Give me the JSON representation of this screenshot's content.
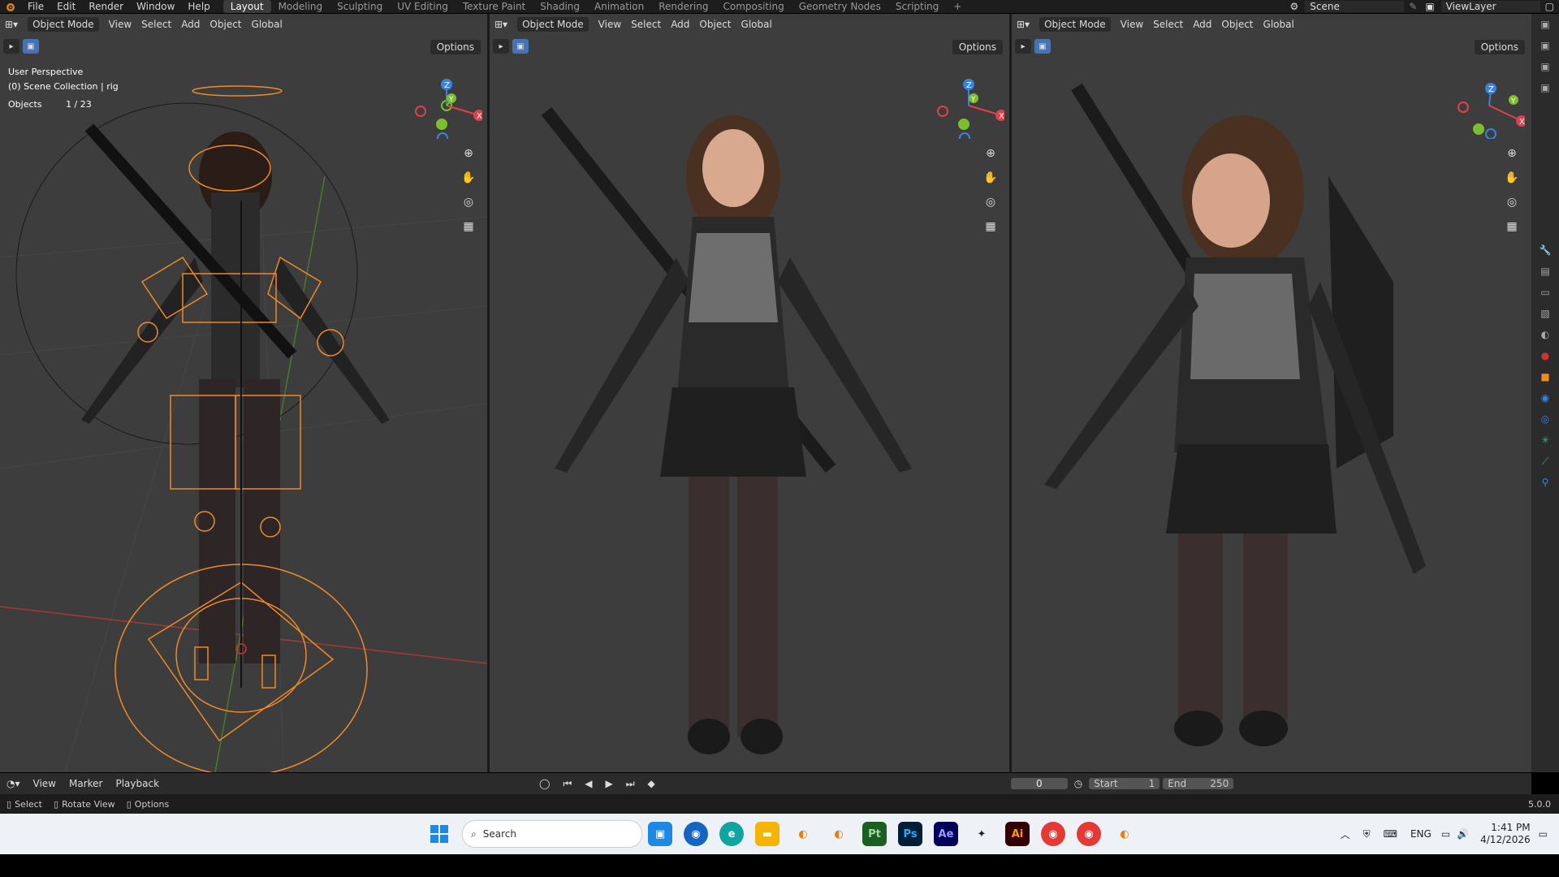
{
  "topbar": {
    "menus": [
      "File",
      "Edit",
      "Render",
      "Window",
      "Help"
    ],
    "workspaces": [
      "Layout",
      "Modeling",
      "Sculpting",
      "UV Editing",
      "Texture Paint",
      "Shading",
      "Animation",
      "Rendering",
      "Compositing",
      "Geometry Nodes",
      "Scripting",
      "+"
    ],
    "active_workspace": "Layout",
    "scene_field": "Scene",
    "viewlayer_field": "ViewLayer"
  },
  "viewport": {
    "mode": "Object Mode",
    "menus": [
      "View",
      "Select",
      "Add",
      "Object"
    ],
    "transform": "Global",
    "options": "Options"
  },
  "left_info": {
    "perspective": "User Perspective",
    "collection": "(0) Scene Collection | rig",
    "objects_label": "Objects",
    "objects_value": "1 / 23"
  },
  "gizmo_axes": {
    "x": "X",
    "y": "Y",
    "z": "Z"
  },
  "timeline": {
    "menus": [
      "View",
      "Marker",
      "Playback"
    ],
    "current_frame": "0",
    "start_label": "Start",
    "start_value": "1",
    "end_label": "End",
    "end_value": "250"
  },
  "statusbar": {
    "select": "Select",
    "rotate": "Rotate View",
    "options": "Options",
    "version": "5.0.0"
  },
  "taskbar": {
    "search_placeholder": "Search",
    "lang": "ENG",
    "time": "1:41 PM",
    "date": "4/12/2026",
    "apps": [
      {
        "name": "Pt",
        "color": "#1b5e20"
      },
      {
        "name": "Ps",
        "color": "#001e36"
      },
      {
        "name": "Ae",
        "color": "#00005b"
      },
      {
        "name": "Ai",
        "color": "#330000"
      }
    ]
  },
  "colors": {
    "accent_orange": "#f08a24",
    "axis_x": "#e0404a",
    "axis_y": "#7cbf2e",
    "axis_z": "#3a82e0"
  }
}
